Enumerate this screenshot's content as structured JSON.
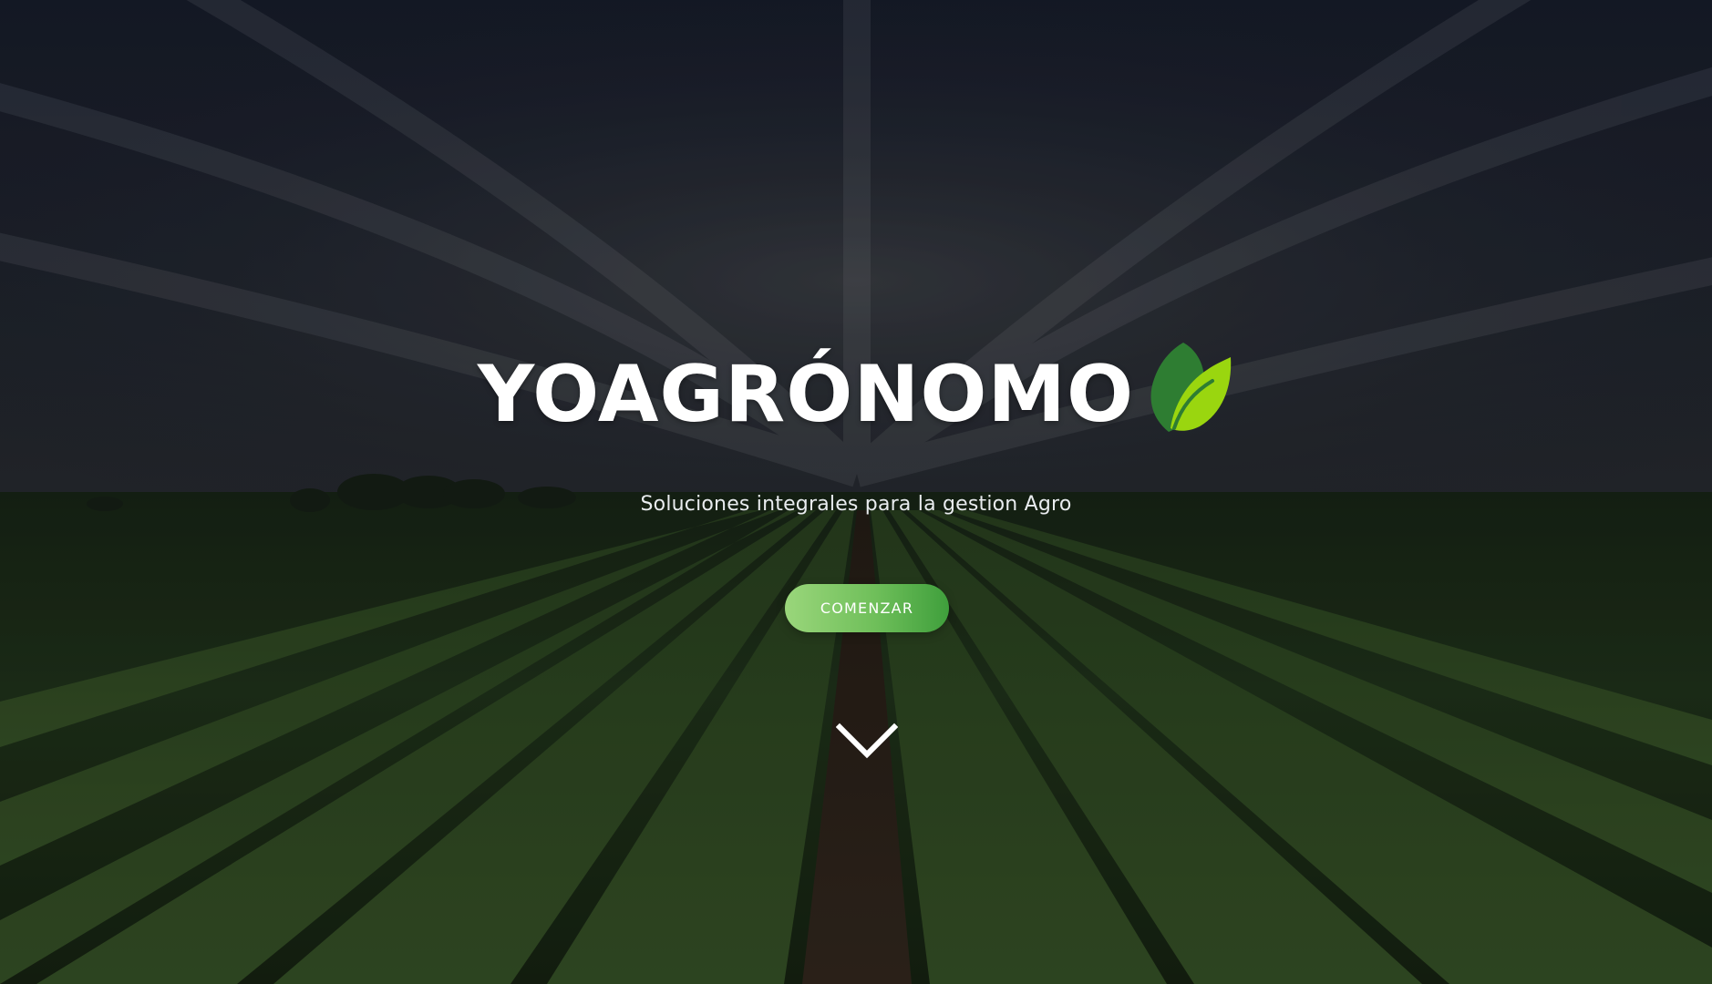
{
  "hero": {
    "title": "YOAGRÓNOMO",
    "subtitle": "Soluciones integrales para la gestion Agro",
    "cta_label": "COMENZAR",
    "logo_icon": "leaf-icon",
    "scroll_icon": "chevron-down-icon"
  },
  "colors": {
    "leaf_dark": "#2e7d32",
    "leaf_light": "#9ad60f",
    "button_start": "#9ad67b",
    "button_end": "#3f9f3c",
    "text": "#ffffff"
  }
}
